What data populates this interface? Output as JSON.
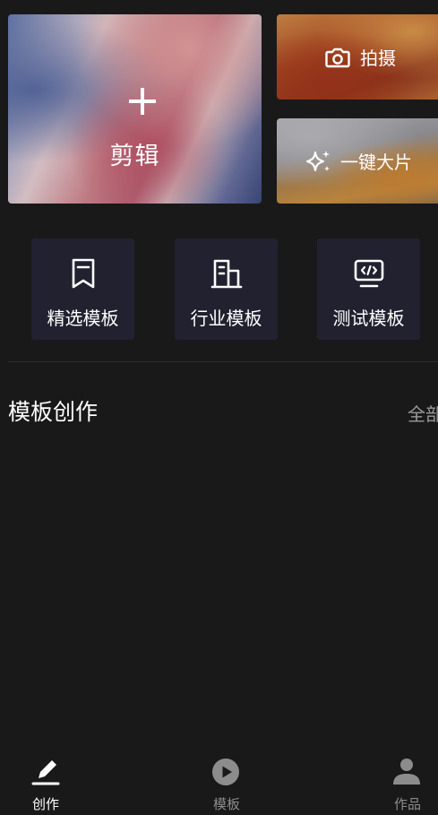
{
  "top_cards": {
    "edit": {
      "label": "剪辑",
      "icon": "plus-icon"
    },
    "shoot": {
      "label": "拍摄",
      "icon": "camera-icon"
    },
    "one_click": {
      "label": "一键大片",
      "icon": "sparkle-icon"
    }
  },
  "template_buttons": [
    {
      "label": "精选模板",
      "icon": "bookmark-icon"
    },
    {
      "label": "行业模板",
      "icon": "building-icon"
    },
    {
      "label": "测试模板",
      "icon": "code-monitor-icon"
    }
  ],
  "section": {
    "title": "模板创作",
    "all_link": "全部"
  },
  "tabbar": {
    "items": [
      {
        "label": "创作",
        "icon": "pen-icon",
        "active": true
      },
      {
        "label": "模板",
        "icon": "play-circle-icon",
        "active": false
      },
      {
        "label": "作品",
        "icon": "user-icon",
        "active": false
      }
    ]
  },
  "colors": {
    "background": "#191919",
    "tile_background": "#212130",
    "active_tab": "#ffffff",
    "inactive_tab": "#8c8c8c",
    "secondary_text": "#9a9a9a"
  }
}
